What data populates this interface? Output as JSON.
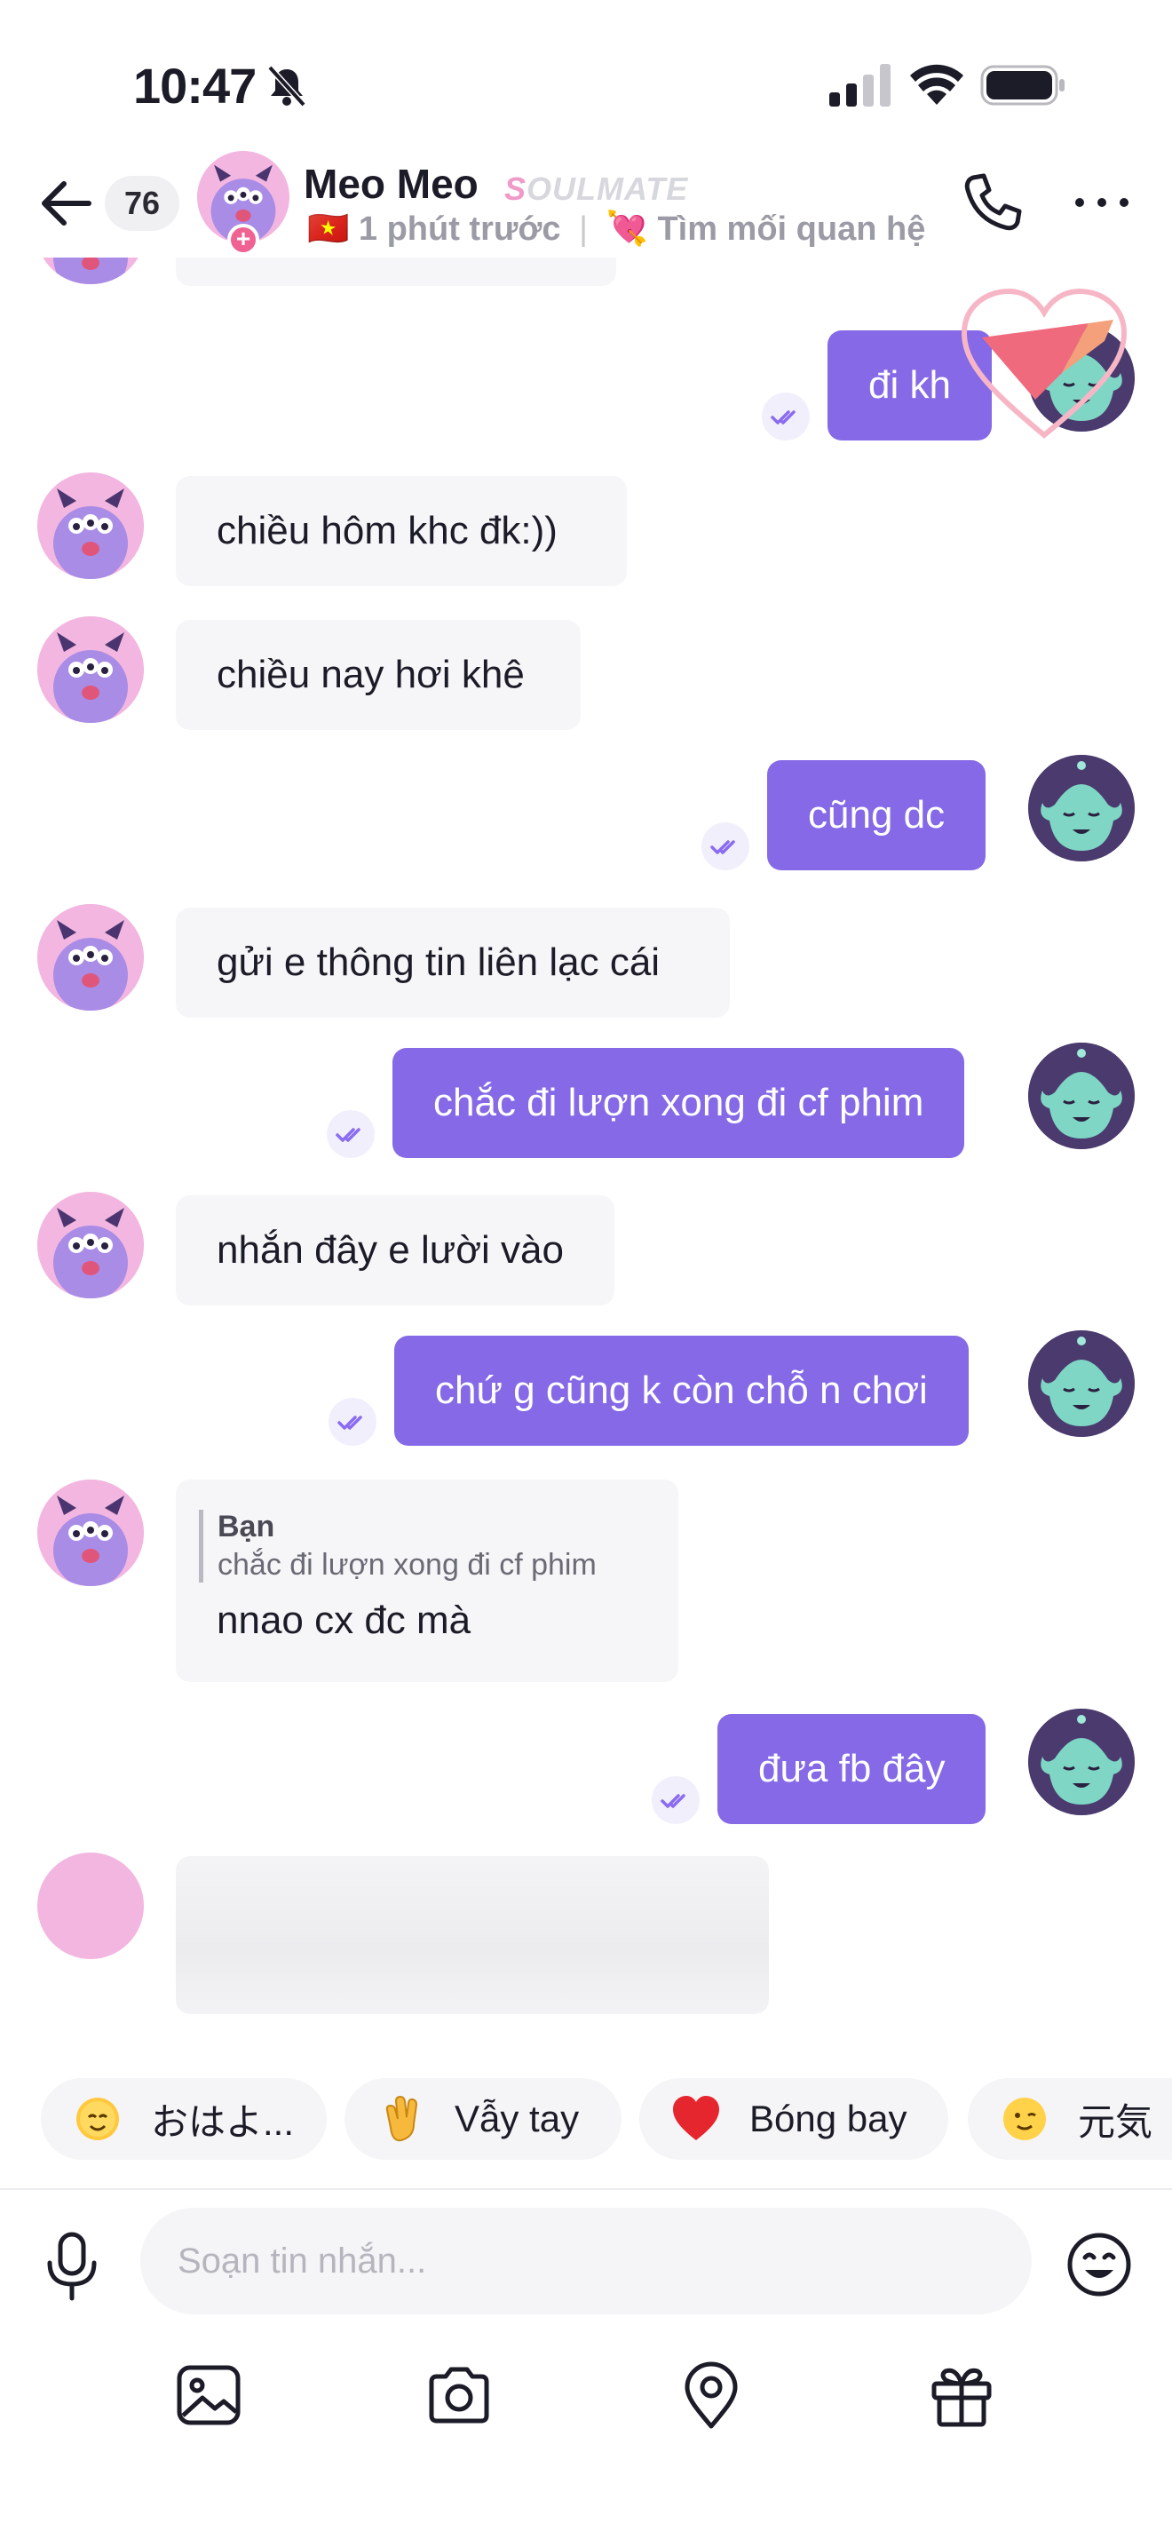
{
  "status_bar": {
    "time": "10:47"
  },
  "header": {
    "unread_count": "76",
    "contact_name": "Meo Meo",
    "badge_first": "S",
    "badge_rest": "OULMATE",
    "flag": "🇻🇳",
    "last_seen": "1 phút trước",
    "separator": "|",
    "status_emoji": "💘",
    "status_text": "Tìm mối quan hệ"
  },
  "messages": [
    {
      "from": "me",
      "text": "đi kh"
    },
    {
      "from": "them",
      "text": "chiều hôm khc đk:))"
    },
    {
      "from": "them",
      "text": "chiều nay hơi khê"
    },
    {
      "from": "me",
      "text": "cũng dc"
    },
    {
      "from": "them",
      "text": "gửi e thông tin liên lạc cái"
    },
    {
      "from": "me",
      "text": "chắc đi lượn xong đi cf phim"
    },
    {
      "from": "them",
      "text": "nhắn đây e lười vào"
    },
    {
      "from": "me",
      "text": "chứ g cũng k còn chỗ n chơi"
    },
    {
      "from": "them",
      "reply_to_label": "Bạn",
      "reply_to_text": "chắc đi lượn xong đi cf phim",
      "text": "nnao cx đc mà"
    },
    {
      "from": "me",
      "text": "đưa fb đây"
    }
  ],
  "quick_replies": [
    {
      "icon": "sun-face-icon",
      "label": "おはよ..."
    },
    {
      "icon": "waving-hand-icon",
      "label": "Vẫy tay"
    },
    {
      "icon": "red-heart-icon",
      "label": "Bóng bay"
    },
    {
      "icon": "winking-face-icon",
      "label": "元気"
    }
  ],
  "composer": {
    "placeholder": "Soạn tin nhắn..."
  },
  "colors": {
    "accent": "#8569e6",
    "incoming_bubble": "#f6f6f8",
    "read_tick": "#8a6cf0"
  }
}
